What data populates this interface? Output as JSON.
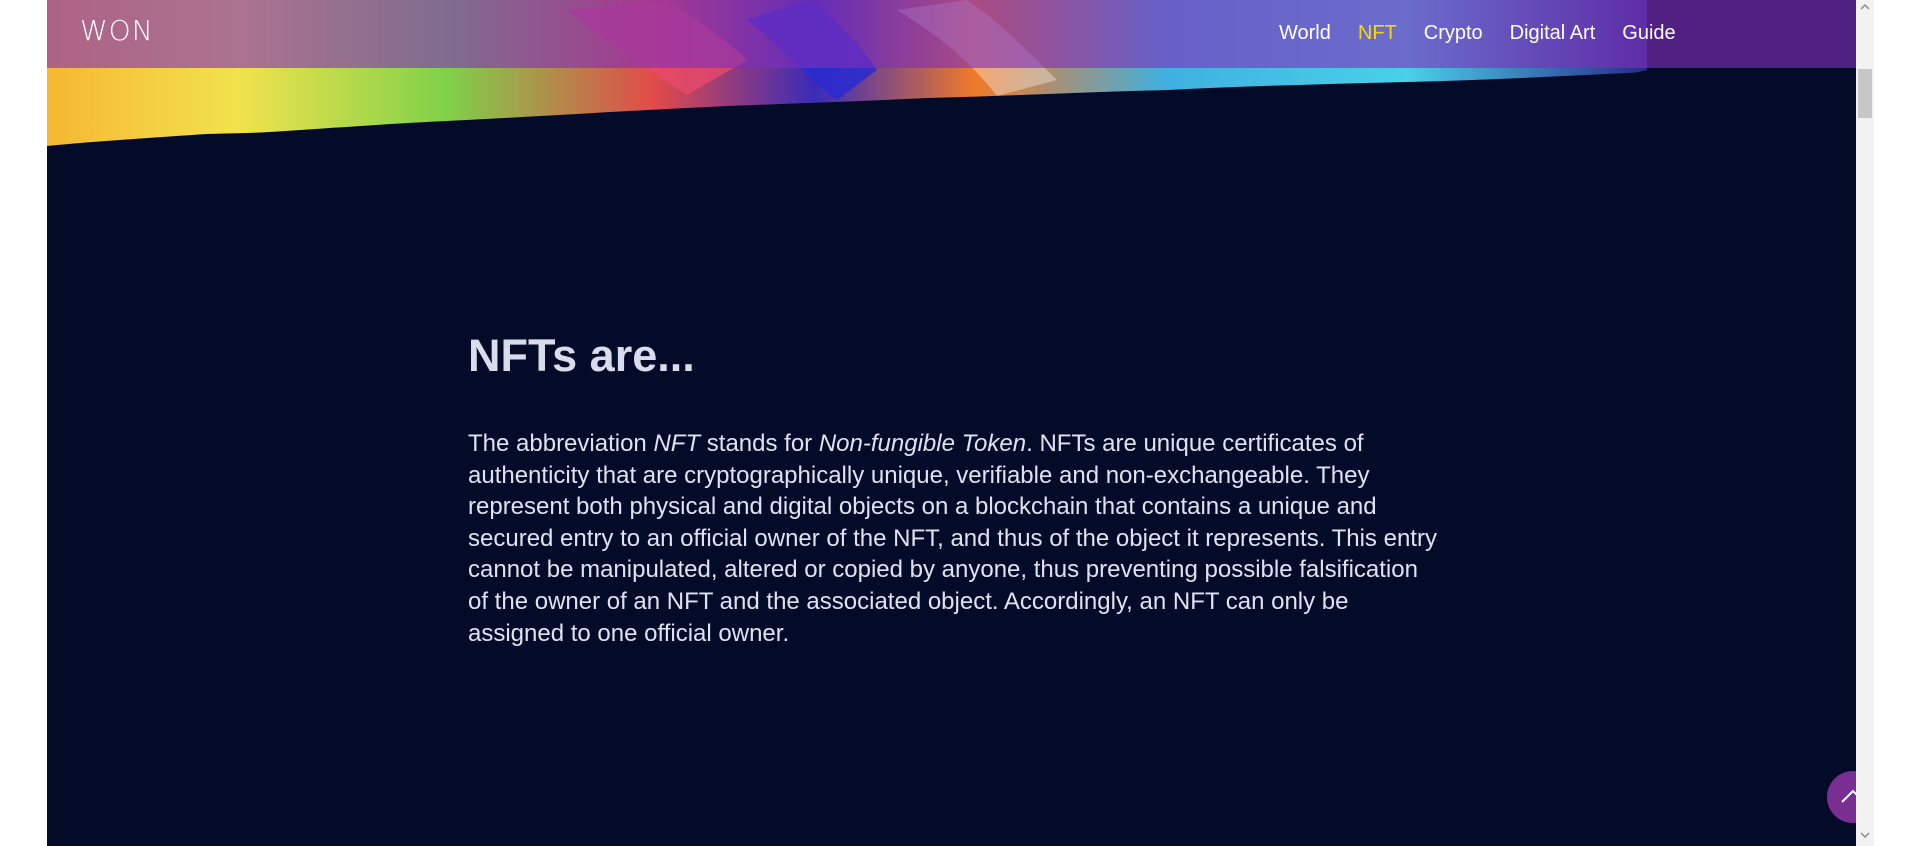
{
  "header": {
    "logo_text": "WON",
    "nav": [
      {
        "label": "World",
        "active": false
      },
      {
        "label": "NFT",
        "active": true
      },
      {
        "label": "Crypto",
        "active": false
      },
      {
        "label": "Digital Art",
        "active": false
      },
      {
        "label": "Guide",
        "active": false
      }
    ]
  },
  "main": {
    "title": "NFTs are...",
    "paragraph": {
      "t1": "The abbreviation ",
      "em1": "NFT",
      "t2": " stands for ",
      "em2": "Non-fungible Token",
      "t3": ". NFTs are unique certificates of authenticity that are cryptographically unique, verifiable and non-exchangeable. They represent both physical and digital objects on a blockchain that contains a unique and secured entry to an official owner of the NFT, and thus of the object it represents. This entry cannot be manipulated, altered or copied by anyone, thus preventing possible falsification of the owner of an NFT and the associated object. Accordingly, an NFT can only be assigned to one official owner."
    }
  },
  "controls": {
    "back_to_top_icon": "chevron-up-icon",
    "scroll_up_icon": "triangle-up-icon",
    "scroll_down_icon": "triangle-down-icon"
  },
  "colors": {
    "page_background": "#040b29",
    "navbar": "#802eba",
    "active_nav": "#f5d90a",
    "back_to_top": "#7a2e93"
  }
}
